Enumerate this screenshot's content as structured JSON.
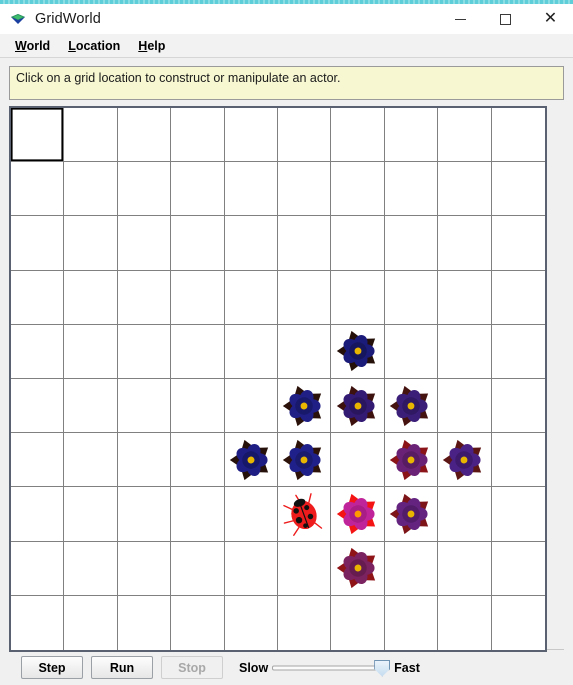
{
  "window": {
    "title": "GridWorld",
    "icon": "gridworld-diamond-icon",
    "controls": {
      "minimize": "—",
      "maximize": "□",
      "close": "✕"
    }
  },
  "menubar": {
    "items": [
      {
        "label": "World",
        "mnemonic": "W",
        "rest": "orld"
      },
      {
        "label": "Location",
        "mnemonic": "L",
        "rest": "ocation"
      },
      {
        "label": "Help",
        "mnemonic": "H",
        "rest": "elp"
      }
    ]
  },
  "message": {
    "text": "Click on a grid location to construct or manipulate an actor."
  },
  "grid": {
    "rows": 10,
    "columns": 10,
    "selected_cell": {
      "row": 0,
      "col": 0
    },
    "cell_border_color": "#808080",
    "background_color": "#ffffff",
    "actors": [
      {
        "row": 4,
        "col": 6,
        "type": "flower",
        "color": "#1b1b7a",
        "petal_shade": "#16165f",
        "tip": "#241008"
      },
      {
        "row": 5,
        "col": 5,
        "type": "flower",
        "color": "#1f1f86",
        "petal_shade": "#19196b",
        "tip": "#2a1109"
      },
      {
        "row": 5,
        "col": 6,
        "type": "flower",
        "color": "#331b74",
        "petal_shade": "#2a165e",
        "tip": "#3d120e"
      },
      {
        "row": 5,
        "col": 7,
        "type": "flower",
        "color": "#3a1e78",
        "petal_shade": "#301862",
        "tip": "#461410"
      },
      {
        "row": 6,
        "col": 4,
        "type": "flower",
        "color": "#1d1d84",
        "petal_shade": "#171769",
        "tip": "#26100a"
      },
      {
        "row": 6,
        "col": 5,
        "type": "flower",
        "color": "#20208a",
        "petal_shade": "#1a1a6e",
        "tip": "#2c1209"
      },
      {
        "row": 6,
        "col": 7,
        "type": "flower",
        "color": "#6a2277",
        "petal_shade": "#581c62",
        "tip": "#8a1418"
      },
      {
        "row": 6,
        "col": 8,
        "type": "flower",
        "color": "#4a2184",
        "petal_shade": "#3d1a6c",
        "tip": "#5c1614"
      },
      {
        "row": 7,
        "col": 5,
        "type": "bug",
        "color": "#ee1c1c",
        "spot_color": "#111111",
        "direction": "west"
      },
      {
        "row": 7,
        "col": 6,
        "type": "flower",
        "color": "#c0249a",
        "petal_shade": "#a81d86",
        "tip": "#f41414",
        "center": "#ff9a00"
      },
      {
        "row": 7,
        "col": 7,
        "type": "flower",
        "color": "#63237f",
        "petal_shade": "#521c69",
        "tip": "#7d1418"
      },
      {
        "row": 8,
        "col": 6,
        "type": "flower",
        "color": "#7b2260",
        "petal_shade": "#671c50",
        "tip": "#8e1418"
      }
    ],
    "flower_center_color": "#e8b500"
  },
  "toolbar": {
    "step_label": "Step",
    "run_label": "Run",
    "stop_label": "Stop",
    "stop_enabled": false,
    "slow_label": "Slow",
    "fast_label": "Fast",
    "speed_value": 100
  }
}
